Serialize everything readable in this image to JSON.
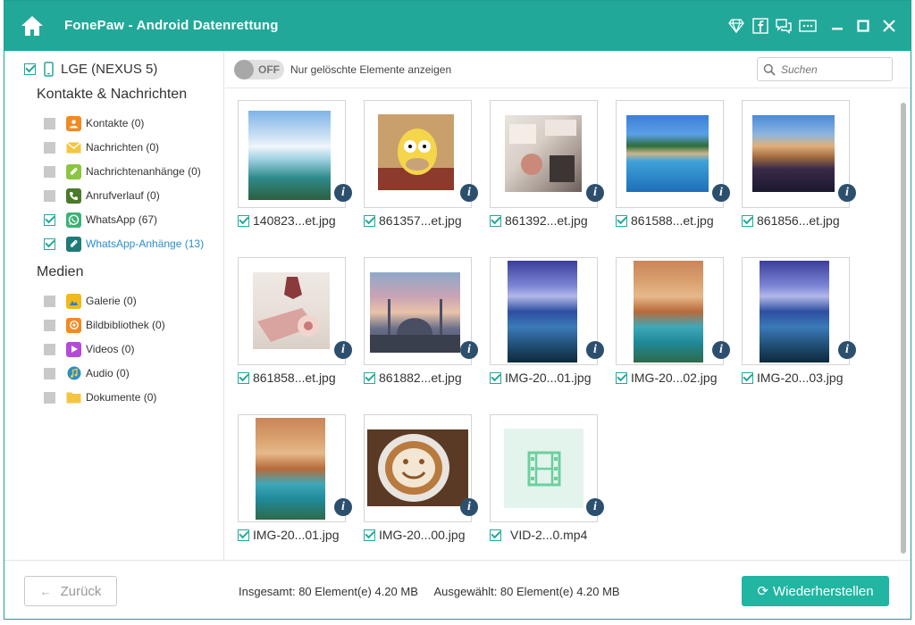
{
  "app": {
    "title": "FonePaw - Android Datenrettung",
    "icons": [
      "home-icon",
      "premium-diamond-icon",
      "facebook-icon",
      "feedback-icon",
      "menu-icon",
      "minimize-icon",
      "maximize-icon",
      "close-icon"
    ],
    "accent_color": "#22a899"
  },
  "sidebar": {
    "device": "LGE (NEXUS 5)",
    "sections": [
      {
        "title": "Kontakte & Nachrichten",
        "items": [
          {
            "label": "Kontakte (0)",
            "checked": false,
            "icon": "contacts-icon",
            "color": "#f08a24"
          },
          {
            "label": "Nachrichten (0)",
            "checked": false,
            "icon": "messages-icon",
            "color": "#f5c542"
          },
          {
            "label": "Nachrichtenanhänge (0)",
            "checked": false,
            "icon": "attachment-icon",
            "color": "#8cc63f"
          },
          {
            "label": "Anrufverlauf (0)",
            "checked": false,
            "icon": "call-log-icon",
            "color": "#4a7a2a"
          },
          {
            "label": "WhatsApp (67)",
            "checked": true,
            "icon": "whatsapp-icon",
            "color": "#3bb273"
          },
          {
            "label": "WhatsApp-Anhänge (13)",
            "checked": true,
            "icon": "whatsapp-attachment-icon",
            "color": "#1f7a7a",
            "active": true
          }
        ]
      },
      {
        "title": "Medien",
        "items": [
          {
            "label": "Galerie (0)",
            "checked": false,
            "icon": "gallery-icon",
            "color": "#f2b81c"
          },
          {
            "label": "Bildbibliothek (0)",
            "checked": false,
            "icon": "image-library-icon",
            "color": "#f08a24"
          },
          {
            "label": "Videos (0)",
            "checked": false,
            "icon": "videos-icon",
            "color": "#b44ad6"
          },
          {
            "label": "Audio (0)",
            "checked": false,
            "icon": "audio-icon",
            "color": "#2a8fc8"
          },
          {
            "label": "Dokumente (0)",
            "checked": false,
            "icon": "documents-icon",
            "color": "#f5c542"
          }
        ]
      }
    ]
  },
  "toolbar": {
    "toggle_state": "OFF",
    "toggle_label": "Nur gelöschte Elemente anzeigen",
    "search_placeholder": "Suchen"
  },
  "files": [
    {
      "name": "140823...et.jpg",
      "checked": true,
      "thumb": "waterfall"
    },
    {
      "name": "861357...et.jpg",
      "checked": true,
      "thumb": "cartoon"
    },
    {
      "name": "861392...et.jpg",
      "checked": true,
      "thumb": "table"
    },
    {
      "name": "861588...et.jpg",
      "checked": true,
      "thumb": "pool"
    },
    {
      "name": "861856...et.jpg",
      "checked": true,
      "thumb": "night-city"
    },
    {
      "name": "861858...et.jpg",
      "checked": true,
      "thumb": "dessert"
    },
    {
      "name": "861882...et.jpg",
      "checked": true,
      "thumb": "mosque"
    },
    {
      "name": "IMG-20...01.jpg",
      "checked": true,
      "thumb": "city-portrait"
    },
    {
      "name": "IMG-20...02.jpg",
      "checked": true,
      "thumb": "village-river"
    },
    {
      "name": "IMG-20...03.jpg",
      "checked": true,
      "thumb": "city-portrait"
    },
    {
      "name": "IMG-20...01.jpg",
      "checked": true,
      "thumb": "village-river"
    },
    {
      "name": "IMG-20...00.jpg",
      "checked": true,
      "thumb": "coffee"
    },
    {
      "name": "VID-2...0.mp4",
      "checked": true,
      "thumb": "video"
    }
  ],
  "footer": {
    "back_label": "Zurück",
    "total_text": "Insgesamt: 80 Element(e) 4.20 MB",
    "selected_text": "Ausgewählt: 80 Element(e) 4.20 MB",
    "restore_label": "Wiederherstellen"
  }
}
